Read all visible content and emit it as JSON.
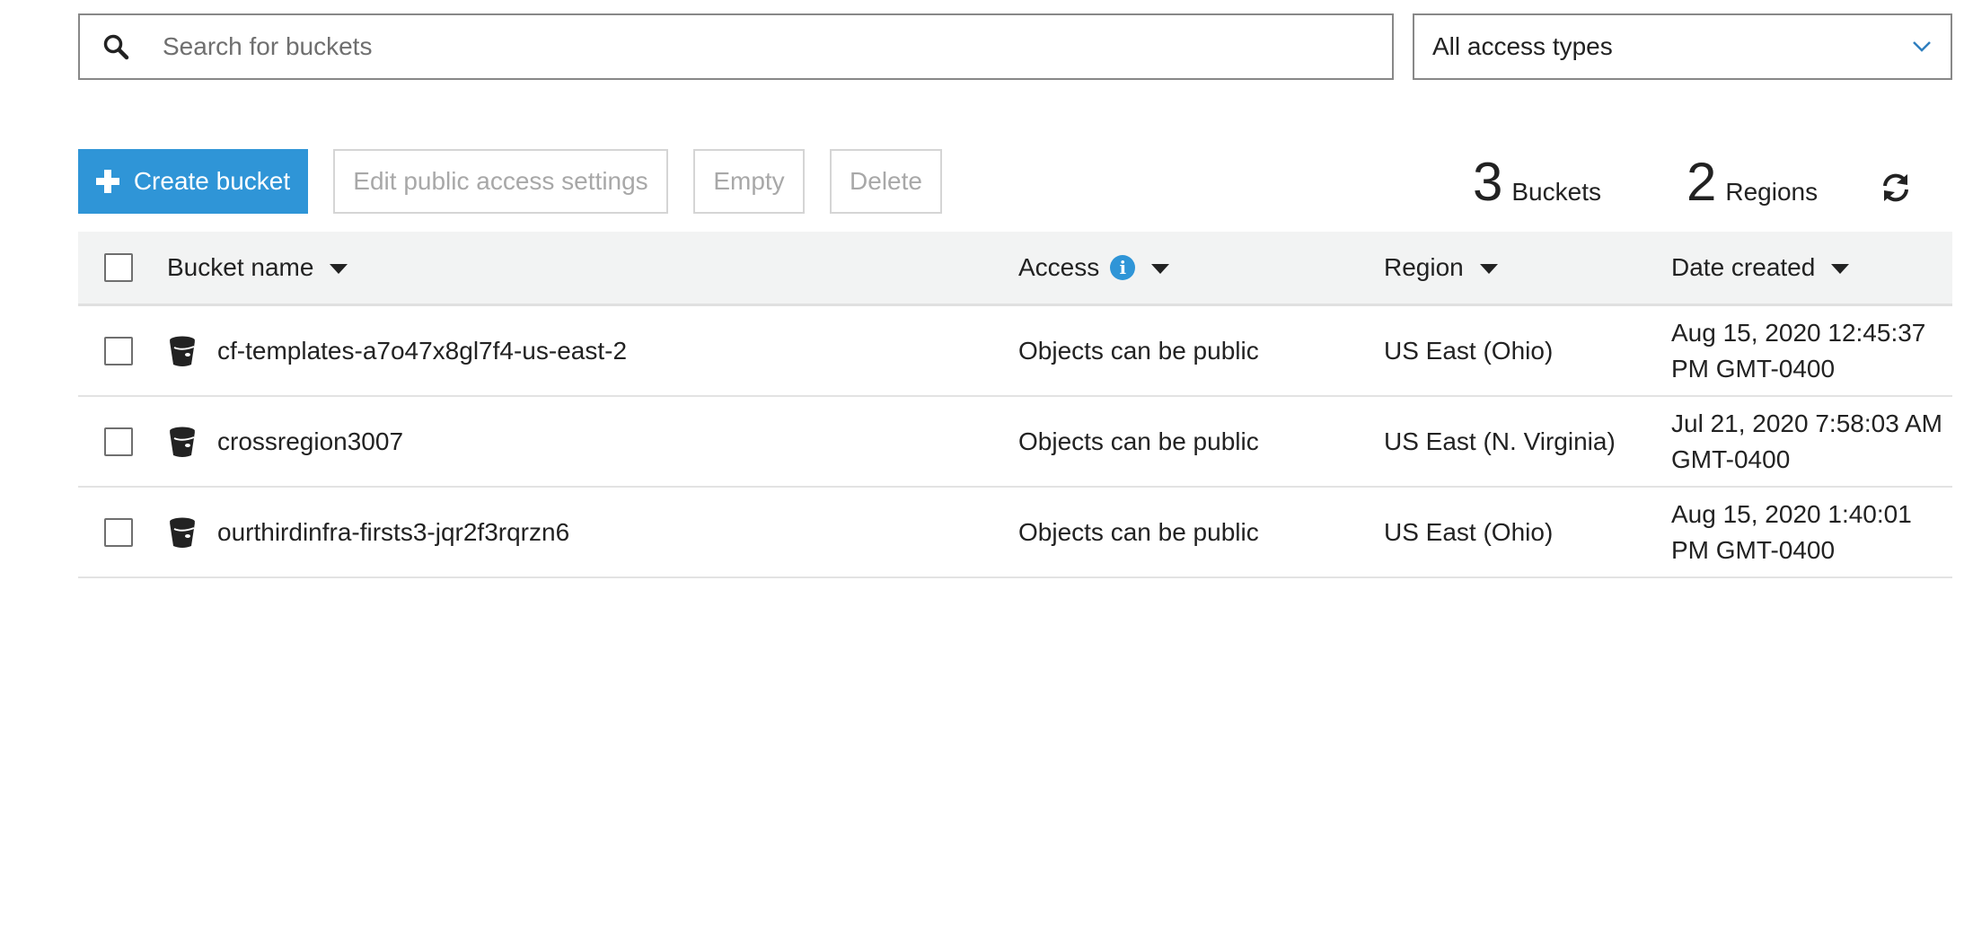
{
  "search": {
    "placeholder": "Search for buckets",
    "icon": "search-icon"
  },
  "filter": {
    "selected": "All access types",
    "icon": "chevron-down-icon"
  },
  "toolbar": {
    "create_label": "Create bucket",
    "edit_label": "Edit public access settings",
    "empty_label": "Empty",
    "delete_label": "Delete"
  },
  "summary": {
    "bucket_count": "3",
    "bucket_label": "Buckets",
    "region_count": "2",
    "region_label": "Regions"
  },
  "colors": {
    "primary": "#2f95d7",
    "header_bg": "#f2f3f3",
    "disabled_text": "#a8a8a8"
  },
  "table": {
    "headers": {
      "name": "Bucket name",
      "access": "Access",
      "region": "Region",
      "date": "Date created"
    },
    "rows": [
      {
        "name": "cf-templates-a7o47x8gl7f4-us-east-2",
        "access": "Objects can be public",
        "region": "US East (Ohio)",
        "date": "Aug 15, 2020 12:45:37 PM GMT-0400"
      },
      {
        "name": "crossregion3007",
        "access": "Objects can be public",
        "region": "US East (N. Virginia)",
        "date": "Jul 21, 2020 7:58:03 AM GMT-0400"
      },
      {
        "name": "ourthirdinfra-firsts3-jqr2f3rqrzn6",
        "access": "Objects can be public",
        "region": "US East (Ohio)",
        "date": "Aug 15, 2020 1:40:01 PM GMT-0400"
      }
    ]
  }
}
